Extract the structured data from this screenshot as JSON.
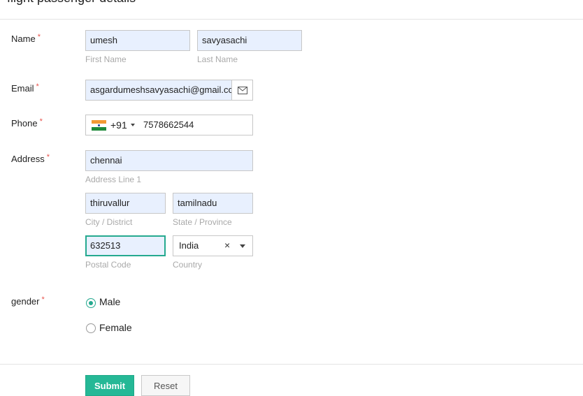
{
  "header": {
    "title": "flight passenger details"
  },
  "form": {
    "name": {
      "label": "Name",
      "required": "*",
      "first": {
        "value": "umesh",
        "hint": "First Name"
      },
      "last": {
        "value": "savyasachi",
        "hint": "Last Name"
      }
    },
    "email": {
      "label": "Email",
      "required": "*",
      "value": "asgardumeshsavyasachi@gmail.com",
      "icon": "envelope-icon"
    },
    "phone": {
      "label": "Phone",
      "required": "*",
      "country_code": "+91",
      "flag": "india-flag-icon",
      "value": "7578662544"
    },
    "address": {
      "label": "Address",
      "required": "*",
      "line1": {
        "value": "chennai",
        "hint": "Address Line 1"
      },
      "city": {
        "value": "thiruvallur",
        "hint": "City / District"
      },
      "state": {
        "value": "tamilnadu",
        "hint": "State / Province"
      },
      "postal": {
        "value": "632513",
        "hint": "Postal Code"
      },
      "country": {
        "value": "India",
        "hint": "Country",
        "clear": "×"
      }
    },
    "gender": {
      "label": "gender",
      "required": "*",
      "options": [
        {
          "label": "Male",
          "checked": true
        },
        {
          "label": "Female",
          "checked": false
        }
      ]
    }
  },
  "actions": {
    "submit": "Submit",
    "reset": "Reset"
  },
  "colors": {
    "accent": "#25b896",
    "field_bg": "#e8f0fe",
    "required": "#e8524b"
  }
}
